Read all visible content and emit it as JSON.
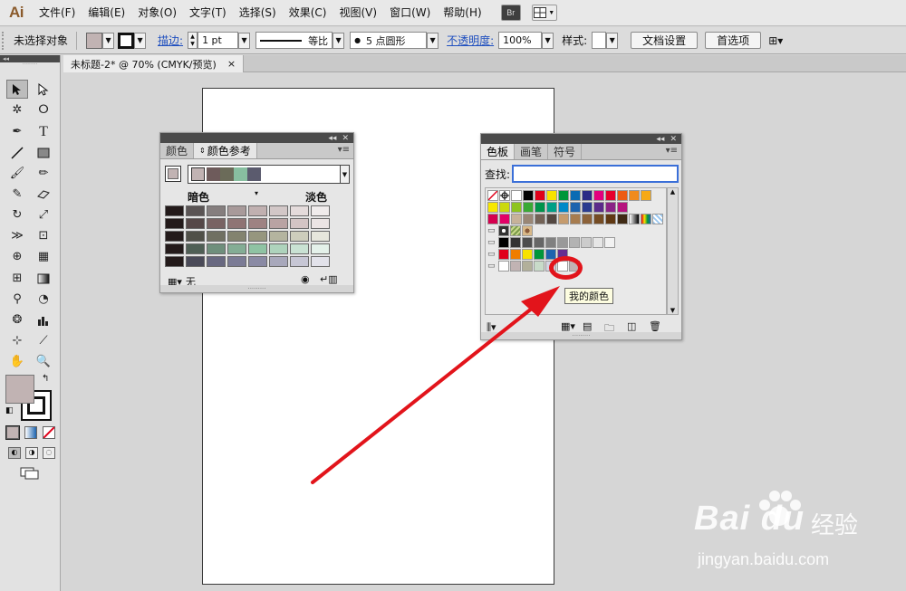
{
  "app": {
    "logo": "Ai"
  },
  "menubar": {
    "items": [
      "文件(F)",
      "编辑(E)",
      "对象(O)",
      "文字(T)",
      "选择(S)",
      "效果(C)",
      "视图(V)",
      "窗口(W)",
      "帮助(H)"
    ],
    "bridge_label": "Br"
  },
  "controlbar": {
    "selection_status": "未选择对象",
    "stroke_label": "描边:",
    "stroke_weight": "1 pt",
    "stroke_profile": "等比",
    "brush": "5 点圆形",
    "opacity_label": "不透明度:",
    "opacity_value": "100%",
    "style_label": "样式:",
    "doc_setup_button": "文档设置",
    "prefs_button": "首选项"
  },
  "document_tab": {
    "title": "未标题-2* @ 70% (CMYK/预览)",
    "close": "×"
  },
  "toolbox": {
    "fill_color": "#c1b3b3",
    "stroke_color": "#000000"
  },
  "color_guide_panel": {
    "tabs": [
      "颜色",
      "颜色参考"
    ],
    "active_tab": "颜色参考",
    "harmony_colors": [
      "#c1b3b3",
      "#6e5b5b",
      "#6b6b59",
      "#88bfa0",
      "#5b5b6e"
    ],
    "dark_label": "暗色",
    "light_label": "淡色",
    "none_label": "无",
    "grid": [
      [
        "#231a1a",
        "#5a5454",
        "#857e7e",
        "#a89a9a",
        "#c0b0b0",
        "#d2c7c7",
        "#e4dbdb",
        "#f0ecec"
      ],
      [
        "#231a1a",
        "#554747",
        "#796363",
        "#8f7474",
        "#9e8282",
        "#b9a3a3",
        "#d3c4c4",
        "#ebe4e4"
      ],
      [
        "#231a1a",
        "#505048",
        "#707062",
        "#83836f",
        "#96967e",
        "#b4b49f",
        "#cdcdbc",
        "#e6e6dc"
      ],
      [
        "#231a1a",
        "#4f5f55",
        "#6f8f7c",
        "#84ad95",
        "#8fc3a3",
        "#aed3bc",
        "#c9e2d3",
        "#e4f1ea"
      ],
      [
        "#231a1a",
        "#4a4a58",
        "#686880",
        "#7b7b95",
        "#8a8aa4",
        "#a8a8bb",
        "#c6c6d4",
        "#e2e2ea"
      ]
    ]
  },
  "swatches_panel": {
    "tabs": [
      "色板",
      "画笔",
      "符号"
    ],
    "active_tab": "色板",
    "search_label": "查找:",
    "search_value": "",
    "rows": [
      [
        "none",
        "registration",
        "#ffffff",
        "#000000",
        "#e0001a",
        "#f7e200",
        "#00963a",
        "#0a6bb3",
        "#2b2a86",
        "#e3007e",
        "#e6002d",
        "#ec5b13",
        "#f08b1d",
        "#f6a916"
      ],
      [
        "#f7e700",
        "#cbd90c",
        "#8ec41f",
        "#3aa935",
        "#00934b",
        "#009f86",
        "#0089c8",
        "#1c63ae",
        "#2b3c8f",
        "#5a2b8a",
        "#8a2386",
        "#b6137e"
      ],
      [
        "#d5004e",
        "#e20067",
        "#c7b299",
        "#998675",
        "#736357",
        "#534741",
        "#c59b6d",
        "#a77c4f",
        "#8c6239",
        "#754c24",
        "#603813",
        "#3f2a14",
        "gradient1",
        "gradient2",
        "pattern"
      ],
      [
        "pattern2",
        "pattern3",
        "pattern4"
      ],
      [
        "#000000",
        "#333333",
        "#4d4d4d",
        "#666666",
        "#808080",
        "#999999",
        "#b3b3b3",
        "#cccccc",
        "#e6e6e6",
        "#f2f2f2"
      ],
      [
        "#e0001a",
        "#ef7d00",
        "#f7e200",
        "#00963a",
        "#1c63ae",
        "#662d91"
      ],
      [
        "#ffffff",
        "#c1b3b3",
        "#b2b09a",
        "#c8dbc9",
        "#d4d4e2",
        "#ffffff",
        "#c1b3b3"
      ]
    ],
    "tooltip": "我的颜色"
  },
  "watermark": {
    "logo": "Bai du",
    "brand": "经验",
    "url": "jingyan.baidu.com"
  },
  "colors": {
    "annotation_red": "#e2141b"
  }
}
